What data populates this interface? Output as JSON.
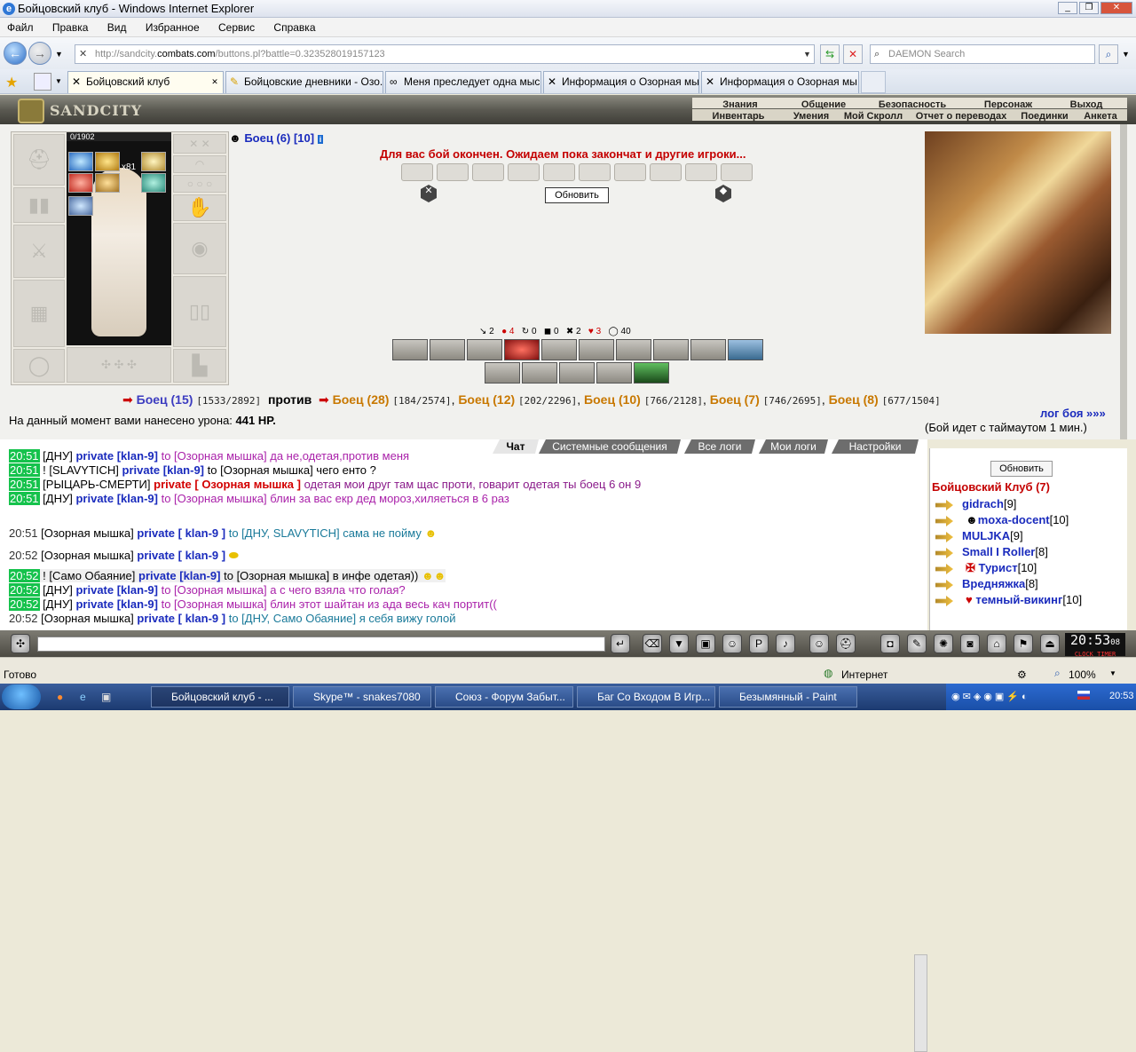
{
  "window": {
    "title": "Бойцовский клуб - Windows Internet Explorer"
  },
  "menu": [
    "Файл",
    "Правка",
    "Вид",
    "Избранное",
    "Сервис",
    "Справка"
  ],
  "address": {
    "prefix": "http://sandcity.",
    "domain": "combats.com",
    "path": "/buttons.pl?battle=0.323528019157123"
  },
  "search": {
    "placeholder": "DAEMON Search"
  },
  "tabs": [
    "Бойцовский клуб",
    "Бойцовские дневники - Озо...",
    "Меня преследует одна мыс...",
    "Информация о Озорная мы...",
    "Информация о Озорная мы..."
  ],
  "game": {
    "logo": "SANDCITY",
    "nav_top": [
      "Знания",
      "Общение",
      "Безопасность",
      "Персонаж",
      "Выход"
    ],
    "nav_bottom": [
      "Инвентарь",
      "Умения",
      "Мой Скролл",
      "Отчет о переводах",
      "Поединки",
      "Анкета"
    ],
    "hp": "0/1902",
    "spell_count": "x81",
    "fighter_name": "Боец (6)",
    "fighter_level": "[10]",
    "finish_msg": "Для вас бой окончен. Ожидаем пока закончат и другие игроки...",
    "refresh_label": "Обновить",
    "stats": [
      "↘ 2",
      "● 4",
      "↻ 0",
      "◼ 0",
      "✖ 2",
      "♥ 3",
      "◯ 40"
    ],
    "vs": {
      "me": "Боец (15)",
      "me_hp": "[1533/2892]",
      "against": "против",
      "enemies": [
        {
          "name": "Боец (28)",
          "hp": "[184/2574]"
        },
        {
          "name": "Боец (12)",
          "hp": "[202/2296]"
        },
        {
          "name": "Боец (10)",
          "hp": "[766/2128]"
        },
        {
          "name": "Боец (7)",
          "hp": "[746/2695]"
        },
        {
          "name": "Боец (8)",
          "hp": "[677/1504]"
        }
      ]
    },
    "damage_text": "На данный момент вами нанесено урона:",
    "damage_value": "441 HP.",
    "log_link": "лог боя »»»",
    "timeout_text": "(Бой идет с таймаутом 1 мин.)"
  },
  "chat": {
    "tabs": [
      "Чат",
      "Системные сообщения",
      "Все логи",
      "Мои логи",
      "Настройки"
    ],
    "lines": [
      {
        "time": "20:51",
        "who": "[ДНУ]",
        "kind": "private [klan-9]",
        "rest": "to [Озорная мышка] да не,одетая,против меня"
      },
      {
        "time": "20:51",
        "who": "! [SLAVYTICH]",
        "kind": "private [klan-9]",
        "rest": "to [Озорная мышка] чего енто ?"
      },
      {
        "time": "20:51",
        "who": "[РЫЦАРЬ-СМЕРТИ]",
        "kind": "private [ Озорная мышка ]",
        "rest": "одетая мои друг там щас проти, говарит одетая ты боец 6 он 9"
      },
      {
        "time": "20:51",
        "who": "[ДНУ]",
        "kind": "private [klan-9]",
        "rest": "to [Озорная мышка] блин за вас екр дед мороз,хиляеться в 6 раз"
      },
      {
        "time": "20:51",
        "who": "[Озорная мышка]",
        "kind": "private [ klan-9 ]",
        "rest": "to [ДНУ, SLAVYTICH] сама не пойму"
      },
      {
        "time": "20:52",
        "who": "[Озорная мышка]",
        "kind": "private [ klan-9 ]",
        "rest": ""
      },
      {
        "time": "20:52",
        "who": "! [Само Обаяние]",
        "kind": "private [klan-9]",
        "rest": "to [Озорная мышка] в инфе одетая))"
      },
      {
        "time": "20:52",
        "who": "[ДНУ]",
        "kind": "private [klan-9]",
        "rest": "to [Озорная мышка] а с чего взяла что голая?"
      },
      {
        "time": "20:52",
        "who": "[ДНУ]",
        "kind": "private [klan-9]",
        "rest": "to [Озорная мышка] блин этот шайтан из ада весь кач портит(("
      },
      {
        "time": "20:52",
        "who": "[Озорная мышка]",
        "kind": "private [ klan-9 ]",
        "rest": "to [ДНУ, Само Обаяние] я себя вижу голой"
      }
    ]
  },
  "roster": {
    "refresh_label": "Обновить",
    "club": "Бойцовский Клуб (7)",
    "members": [
      {
        "name": "gidrach",
        "level": "[9]"
      },
      {
        "name": "moxa-docent",
        "level": "[10]"
      },
      {
        "name": "MULJKA",
        "level": "[9]"
      },
      {
        "name": "Small I Roller",
        "level": "[8]"
      },
      {
        "name": "Турист",
        "level": "[10]"
      },
      {
        "name": "Вредняжка",
        "level": "[8]"
      },
      {
        "name": "темный-викинг",
        "level": "[10]"
      }
    ]
  },
  "clock": {
    "time": "20:53",
    "sec": "08",
    "labels": "CLOCK TIMER"
  },
  "statusbar": {
    "left": "Готово",
    "zone": "Интернет",
    "zoom": "100%"
  },
  "taskbar": {
    "items": [
      "Бойцовский клуб - ...",
      "Skype™ - snakes7080",
      "Союз - Форум Забыт...",
      "Баг Со Входом В Игр...",
      "Безымянный - Paint"
    ],
    "time": "20:53"
  }
}
